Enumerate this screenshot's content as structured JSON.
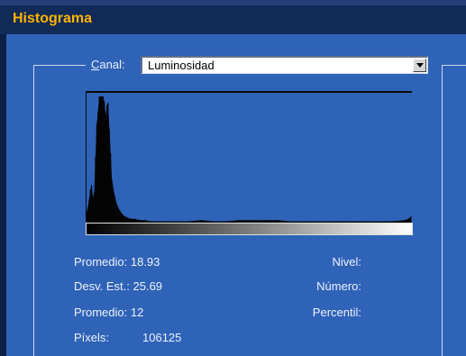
{
  "window": {
    "title": "Histograma"
  },
  "canal": {
    "label_underlined": "C",
    "label_rest": "anal:",
    "value": "Luminosidad"
  },
  "stats": {
    "promedio": "Promedio: 18.93",
    "desv": "Desv. Est.: 25.69",
    "mediana": "Promedio: 12",
    "pixels_label": "Píxels:",
    "pixels_value": "106125",
    "nivel": "Nivel:",
    "numero": "Número:",
    "percentil": "Percentil:"
  },
  "colors": {
    "title": "#ffb400",
    "background": "#2f63b8",
    "titlebar": "#122a58"
  },
  "chart_data": {
    "type": "area",
    "xlabel": "",
    "ylabel": "",
    "xlim": [
      0,
      255
    ],
    "ylim": [
      0,
      100
    ],
    "x": [
      0,
      1,
      2,
      3,
      4,
      5,
      6,
      7,
      8,
      9,
      10,
      11,
      12,
      13,
      14,
      15,
      16,
      17,
      18,
      19,
      20,
      22,
      24,
      26,
      28,
      30,
      32,
      35,
      38,
      42,
      46,
      50,
      55,
      60,
      70,
      80,
      90,
      100,
      110,
      120,
      130,
      140,
      150,
      160,
      170,
      180,
      190,
      200,
      210,
      220,
      230,
      240,
      250,
      253,
      255
    ],
    "values": [
      8,
      12,
      18,
      26,
      30,
      20,
      24,
      52,
      78,
      88,
      100,
      100,
      100,
      100,
      96,
      85,
      93,
      95,
      74,
      55,
      34,
      22,
      14,
      10,
      7,
      5,
      4,
      3,
      3,
      2,
      2,
      1,
      1,
      1,
      1,
      1,
      2,
      1,
      1,
      2,
      2,
      2,
      2,
      1,
      1,
      1,
      1,
      1,
      1,
      1,
      1,
      1,
      2,
      3,
      5
    ]
  }
}
